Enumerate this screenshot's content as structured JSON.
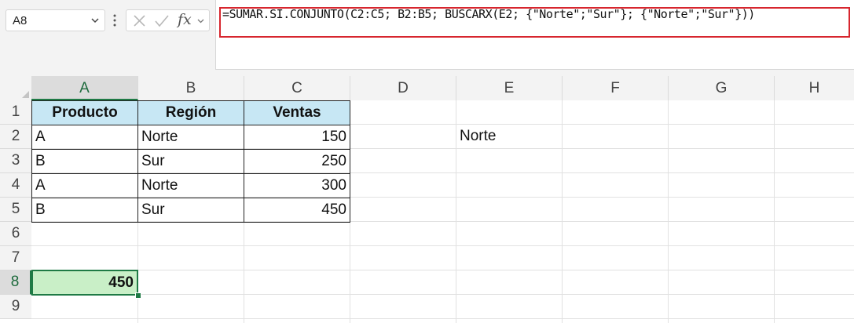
{
  "name_box": {
    "value": "A8"
  },
  "formula_bar": {
    "fx_label": "fx",
    "formula": "=SUMAR.SI.CONJUNTO(C2:C5; B2:B5; BUSCARX(E2; {\"Norte\";\"Sur\"}; {\"Norte\";\"Sur\"}))",
    "highlight_color": "#d7262e"
  },
  "columns": [
    "A",
    "B",
    "C",
    "D",
    "E",
    "F",
    "G",
    "H"
  ],
  "rows": [
    "1",
    "2",
    "3",
    "4",
    "5",
    "6",
    "7",
    "8",
    "9"
  ],
  "active_cell": {
    "column": "A",
    "row": "8"
  },
  "table": {
    "headers": [
      "Producto",
      "Región",
      "Ventas"
    ],
    "rows": [
      [
        "A",
        "Norte",
        "150"
      ],
      [
        "B",
        "Sur",
        "250"
      ],
      [
        "A",
        "Norte",
        "300"
      ],
      [
        "B",
        "Sur",
        "450"
      ]
    ]
  },
  "lookup_cell": {
    "address": "E2",
    "value": "Norte"
  },
  "result_cell": {
    "address": "A8",
    "value": "450"
  },
  "colors": {
    "header_fill": "#c7e7f4",
    "result_fill": "#c9efc7",
    "selection": "#1f7a45"
  }
}
